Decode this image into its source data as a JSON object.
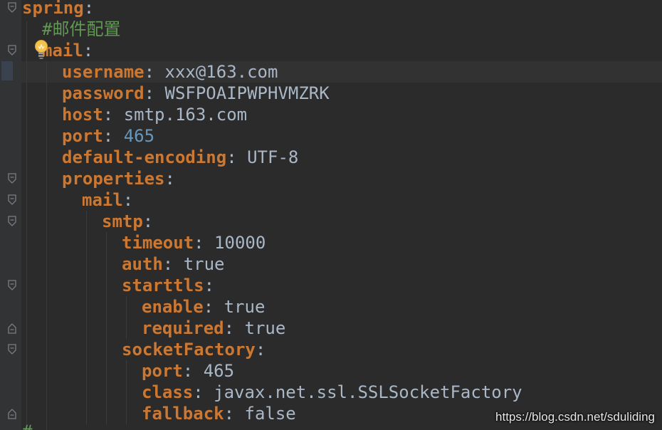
{
  "editor": {
    "lines": [
      {
        "key": "spring",
        "colon": ":"
      },
      {
        "comment": "#邮件配置"
      },
      {
        "key": "mail",
        "colon": ":"
      },
      {
        "key": "username",
        "colon": ":",
        "value": " xxx@163.com"
      },
      {
        "key": "password",
        "colon": ":",
        "value": " WSFPOAIPWPHVMZRK"
      },
      {
        "key": "host",
        "colon": ":",
        "value": " smtp.163.com"
      },
      {
        "key": "port",
        "colon": ":",
        "value": " 465"
      },
      {
        "key": "default-encoding",
        "colon": ":",
        "value": " UTF-8"
      },
      {
        "key": "properties",
        "colon": ":"
      },
      {
        "key": "mail",
        "colon": ":"
      },
      {
        "key": "smtp",
        "colon": ":"
      },
      {
        "key": "timeout",
        "colon": ":",
        "value": " 10000"
      },
      {
        "key": "auth",
        "colon": ":",
        "value": " true"
      },
      {
        "key": "starttls",
        "colon": ":"
      },
      {
        "key": "enable",
        "colon": ":",
        "value": " true"
      },
      {
        "key": "required",
        "colon": ":",
        "value": " true"
      },
      {
        "key": "socketFactory",
        "colon": ":"
      },
      {
        "key": "port",
        "colon": ":",
        "value": " 465"
      },
      {
        "key": "class",
        "colon": ":",
        "value": " javax.net.ssl.SSLSocketFactory"
      },
      {
        "key": "fallback",
        "colon": ":",
        "value": " false"
      },
      {
        "comment": "#"
      }
    ]
  },
  "watermark": "https://blog.csdn.net/sduliding",
  "colors": {
    "background": "#2b2b2b",
    "key": "#cc7832",
    "value": "#a9b7c6",
    "number": "#6897bb",
    "comment": "#629755"
  },
  "icons": {
    "bulb": "lightbulb-icon",
    "fold": "fold-marker-icon"
  }
}
